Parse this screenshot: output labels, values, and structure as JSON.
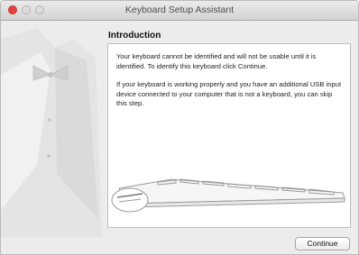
{
  "window": {
    "title": "Keyboard Setup Assistant"
  },
  "content": {
    "heading": "Introduction",
    "paragraph1": "Your keyboard cannot be identified and will not be usable until it is identified. To identify this keyboard click Continue.",
    "paragraph2": "If your keyboard is working properly and you have an additional USB input device connected to your computer that is not a keyboard, you can skip this step."
  },
  "buttons": {
    "continue_label": "Continue"
  },
  "colors": {
    "close_button": "#e0443e",
    "window_bg": "#ececec"
  }
}
